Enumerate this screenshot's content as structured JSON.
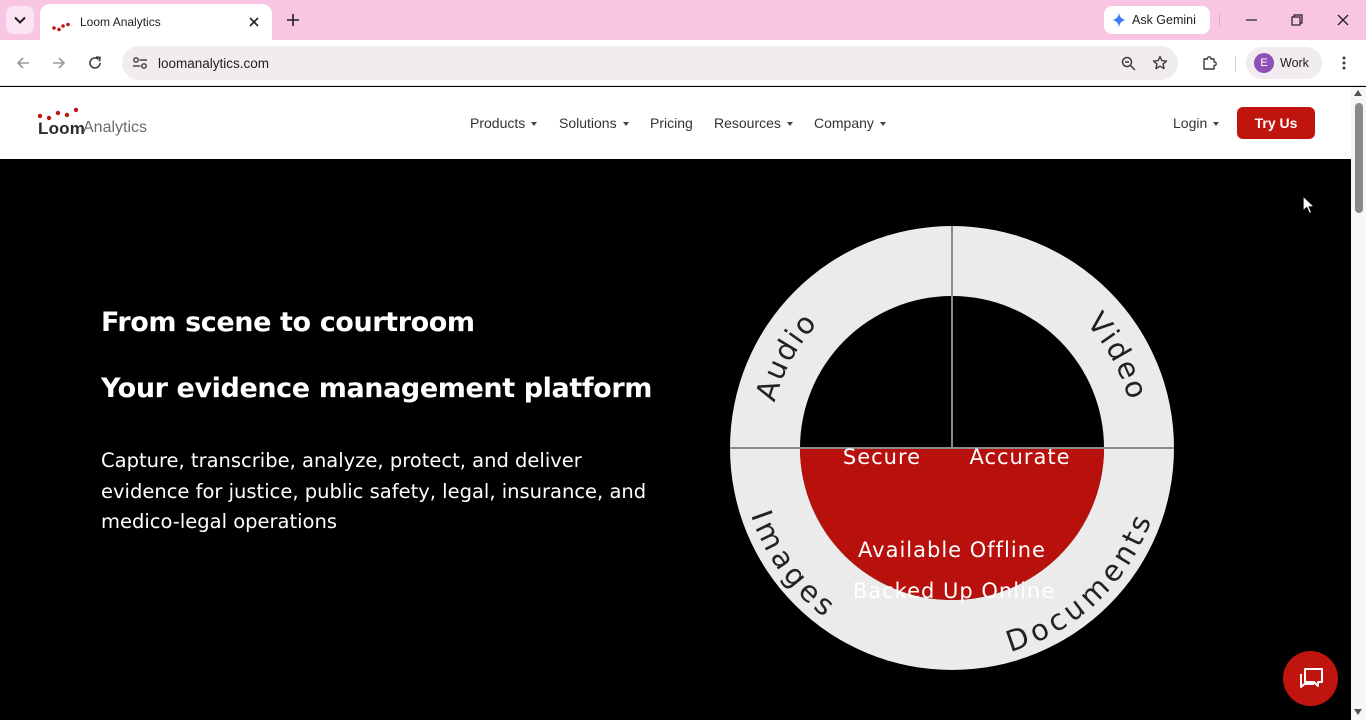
{
  "browser": {
    "tab_title": "Loom Analytics",
    "url": "loomanalytics.com",
    "gemini_label": "Ask Gemini",
    "profile_initial": "E",
    "profile_label": "Work"
  },
  "header": {
    "logo_primary": "Loom",
    "logo_secondary": "Analytics",
    "nav": [
      {
        "label": "Products",
        "dropdown": true
      },
      {
        "label": "Solutions",
        "dropdown": true
      },
      {
        "label": "Pricing",
        "dropdown": false
      },
      {
        "label": "Resources",
        "dropdown": true
      },
      {
        "label": "Company",
        "dropdown": true
      }
    ],
    "login_label": "Login",
    "cta_label": "Try Us"
  },
  "hero": {
    "title_line1": "From scene to courtroom",
    "title_line2": "Your evidence management platform",
    "description": "Capture, transcribe, analyze, protect, and deliver evidence for justice, public safety, legal, insurance, and medico-legal operations"
  },
  "wheel": {
    "outer_labels": [
      "Audio",
      "Video",
      "Images",
      "Documents"
    ],
    "inner_top_left": "Secure",
    "inner_top_right": "Accurate",
    "bottom_line1": "Available Offline",
    "bottom_line2": "Backed Up Online"
  },
  "colors": {
    "brand_red": "#c0140f",
    "tab_strip": "#f8c5e3",
    "hero_bg": "#000000",
    "wheel_ring": "#ebebeb"
  },
  "icons": {
    "chat": "chat-bubble-icon",
    "search_tabs": "chevron-down-icon",
    "zoom": "zoom-icon",
    "bookmark": "star-icon",
    "extensions": "puzzle-icon"
  }
}
